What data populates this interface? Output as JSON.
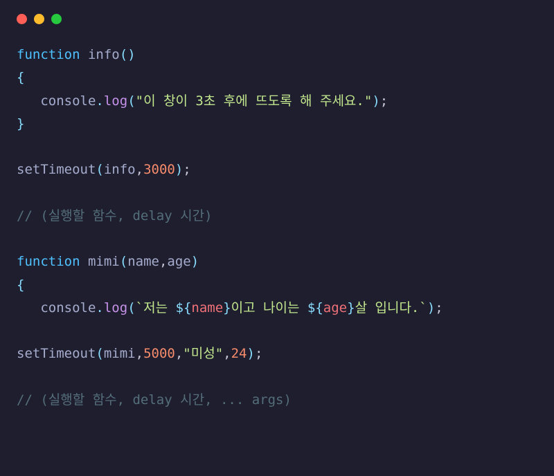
{
  "titlebar": {
    "buttons": [
      "close",
      "minimize",
      "maximize"
    ]
  },
  "code": {
    "l1": {
      "kw": "function",
      "fn": "info",
      "p1": "(",
      "p2": ")"
    },
    "l2": {
      "brace": "{"
    },
    "l3": {
      "indent": "   ",
      "obj": "console",
      "dot": ".",
      "method": "log",
      "p1": "(",
      "q1": "\"",
      "str": "이 창이 3초 후에 뜨도록 해 주세요.",
      "q2": "\"",
      "p2": ")",
      "semi": ";"
    },
    "l4": {
      "brace": "}"
    },
    "l6": {
      "fn": "setTimeout",
      "p1": "(",
      "arg1": "info",
      "comma": ",",
      "num": "3000",
      "p2": ")",
      "semi": ";"
    },
    "l8": {
      "comment": "// (실행할 함수, delay 시간)"
    },
    "l10": {
      "kw": "function",
      "fn": "mimi",
      "p1": "(",
      "arg1": "name",
      "comma": ",",
      "arg2": "age",
      "p2": ")"
    },
    "l11": {
      "brace": "{"
    },
    "l12": {
      "indent": "   ",
      "obj": "console",
      "dot": ".",
      "method": "log",
      "p1": "(",
      "bt1": "`",
      "s1": "저는 ",
      "d1": "${",
      "v1": "name",
      "d2": "}",
      "s2": "이고 나이는 ",
      "d3": "${",
      "v2": "age",
      "d4": "}",
      "s3": "살 입니다.",
      "bt2": "`",
      "p2": ")",
      "semi": ";"
    },
    "l14": {
      "fn": "setTimeout",
      "p1": "(",
      "arg1": "mimi",
      "comma1": ",",
      "num": "5000",
      "comma2": ",",
      "q1": "\"",
      "str": "미성",
      "q2": "\"",
      "comma3": ",",
      "num2": "24",
      "p2": ")",
      "semi": ";"
    },
    "l16": {
      "comment": "// (실행할 함수, delay 시간, ... args)"
    }
  }
}
